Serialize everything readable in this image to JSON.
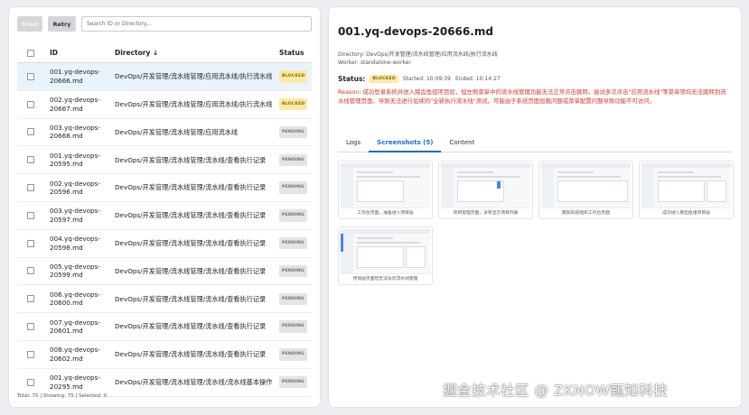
{
  "toolbar": {
    "start_label": "Start",
    "retry_label": "Retry",
    "search_placeholder": "Search ID or Directory..."
  },
  "table": {
    "headers": {
      "id": "ID",
      "directory": "Directory ↓",
      "status": "Status"
    },
    "rows": [
      {
        "id": "001.yq-devops-20666.md",
        "directory": "DevOps/开发管理/流水线管理/应用流水线/执行流水线",
        "status": "BLOCKED",
        "selected": true
      },
      {
        "id": "002.yq-devops-20667.md",
        "directory": "DevOps/开发管理/流水线管理/应用流水线/执行流水线",
        "status": "BLOCKED"
      },
      {
        "id": "003.yq-devops-20668.md",
        "directory": "DevOps/开发管理/流水线管理/应用流水线",
        "status": "PENDING"
      },
      {
        "id": "001.yq-devops-20595.md",
        "directory": "DevOps/开发管理/流水线管理/流水线/查看执行记录",
        "status": "PENDING"
      },
      {
        "id": "002.yq-devops-20596.md",
        "directory": "DevOps/开发管理/流水线管理/流水线/查看执行记录",
        "status": "PENDING"
      },
      {
        "id": "003.yq-devops-20597.md",
        "directory": "DevOps/开发管理/流水线管理/流水线/查看执行记录",
        "status": "PENDING"
      },
      {
        "id": "004.yq-devops-20598.md",
        "directory": "DevOps/开发管理/流水线管理/流水线/查看执行记录",
        "status": "PENDING"
      },
      {
        "id": "005.yq-devops-20599.md",
        "directory": "DevOps/开发管理/流水线管理/流水线/查看执行记录",
        "status": "PENDING"
      },
      {
        "id": "006.yq-devops-20600.md",
        "directory": "DevOps/开发管理/流水线管理/流水线/查看执行记录",
        "status": "PENDING"
      },
      {
        "id": "007.yq-devops-20601.md",
        "directory": "DevOps/开发管理/流水线管理/流水线/查看执行记录",
        "status": "PENDING"
      },
      {
        "id": "008.yq-devops-20602.md",
        "directory": "DevOps/开发管理/流水线管理/流水线/查看执行记录",
        "status": "PENDING"
      },
      {
        "id": "001.yq-devops-20295.md",
        "directory": "DevOps/开发管理/流水线管理/流水线/流水线基本操作",
        "status": "PENDING"
      }
    ]
  },
  "footer": "Total: 75 | Showing: 75 | Selected: 0",
  "detail": {
    "title": "001.yq-devops-20666.md",
    "directory": "Directory: DevOps/开发管理/流水线管理/应用流水线/执行流水线",
    "worker": "Worker: standalone-worker",
    "status_label": "Status:",
    "status": "BLOCKED",
    "started": "Started: 10:09:39",
    "ended": "Ended: 10:14:27",
    "reason": "Reason: 成功登录系统并进入猪齿鱼组项目层，但左侧菜单中的流水线管理功能无法正常点击跳转。尝试多次点击\"应用流水线\"等菜单项均无法跳转到流水线管理页面，导致无法进行后续的\"全新执行流水线\"测试。可能由于系统页面加载问题或菜单配置问题导致功能不可访问。",
    "tabs": [
      "Logs",
      "Screenshots (5)",
      "Content"
    ],
    "active_tab": 1,
    "screenshots": [
      "工作台页面，准备进入项目层",
      "项目管理页面，没有显示项目列表",
      "甄知科技组织工作台页面",
      "成功进入猪齿鱼组项目层",
      "项目层页面但无法访问流水线管理"
    ]
  },
  "watermark": "掘金技术社区 @ ZKNOW甄知科技",
  "colors": {
    "accent": "#1a6bd1",
    "blocked_bg": "#fbe9a6",
    "reason": "#d7372b",
    "selected_row": "#eaf3fc"
  }
}
